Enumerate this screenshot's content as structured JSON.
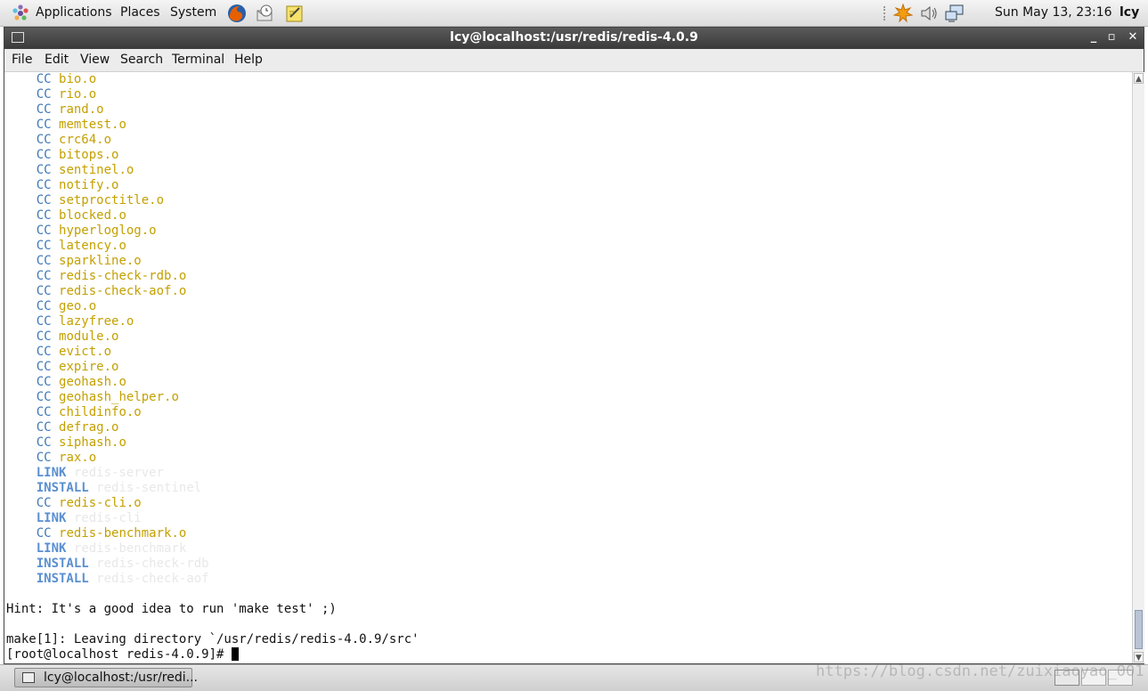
{
  "top_panel": {
    "menus": [
      "Applications",
      "Places",
      "System"
    ],
    "clock": "Sun May 13, 23:16",
    "user": "lcy"
  },
  "window": {
    "title": "lcy@localhost:/usr/redis/redis-4.0.9",
    "controls": [
      "_",
      "▫",
      "✕"
    ]
  },
  "menubar": [
    "File",
    "Edit",
    "View",
    "Search",
    "Terminal",
    "Help"
  ],
  "terminal": {
    "build_lines": [
      {
        "cmd": "CC",
        "arg": "bio.o",
        "style": "cc"
      },
      {
        "cmd": "CC",
        "arg": "rio.o",
        "style": "cc"
      },
      {
        "cmd": "CC",
        "arg": "rand.o",
        "style": "cc"
      },
      {
        "cmd": "CC",
        "arg": "memtest.o",
        "style": "cc"
      },
      {
        "cmd": "CC",
        "arg": "crc64.o",
        "style": "cc"
      },
      {
        "cmd": "CC",
        "arg": "bitops.o",
        "style": "cc"
      },
      {
        "cmd": "CC",
        "arg": "sentinel.o",
        "style": "cc"
      },
      {
        "cmd": "CC",
        "arg": "notify.o",
        "style": "cc"
      },
      {
        "cmd": "CC",
        "arg": "setproctitle.o",
        "style": "cc"
      },
      {
        "cmd": "CC",
        "arg": "blocked.o",
        "style": "cc"
      },
      {
        "cmd": "CC",
        "arg": "hyperloglog.o",
        "style": "cc"
      },
      {
        "cmd": "CC",
        "arg": "latency.o",
        "style": "cc"
      },
      {
        "cmd": "CC",
        "arg": "sparkline.o",
        "style": "cc"
      },
      {
        "cmd": "CC",
        "arg": "redis-check-rdb.o",
        "style": "cc"
      },
      {
        "cmd": "CC",
        "arg": "redis-check-aof.o",
        "style": "cc"
      },
      {
        "cmd": "CC",
        "arg": "geo.o",
        "style": "cc"
      },
      {
        "cmd": "CC",
        "arg": "lazyfree.o",
        "style": "cc"
      },
      {
        "cmd": "CC",
        "arg": "module.o",
        "style": "cc"
      },
      {
        "cmd": "CC",
        "arg": "evict.o",
        "style": "cc"
      },
      {
        "cmd": "CC",
        "arg": "expire.o",
        "style": "cc"
      },
      {
        "cmd": "CC",
        "arg": "geohash.o",
        "style": "cc"
      },
      {
        "cmd": "CC",
        "arg": "geohash_helper.o",
        "style": "cc"
      },
      {
        "cmd": "CC",
        "arg": "childinfo.o",
        "style": "cc"
      },
      {
        "cmd": "CC",
        "arg": "defrag.o",
        "style": "cc"
      },
      {
        "cmd": "CC",
        "arg": "siphash.o",
        "style": "cc"
      },
      {
        "cmd": "CC",
        "arg": "rax.o",
        "style": "cc"
      },
      {
        "cmd": "LINK",
        "arg": "redis-server",
        "style": "link"
      },
      {
        "cmd": "INSTALL",
        "arg": "redis-sentinel",
        "style": "link"
      },
      {
        "cmd": "CC",
        "arg": "redis-cli.o",
        "style": "cc"
      },
      {
        "cmd": "LINK",
        "arg": "redis-cli",
        "style": "link"
      },
      {
        "cmd": "CC",
        "arg": "redis-benchmark.o",
        "style": "cc"
      },
      {
        "cmd": "LINK",
        "arg": "redis-benchmark",
        "style": "link"
      },
      {
        "cmd": "INSTALL",
        "arg": "redis-check-rdb",
        "style": "link"
      },
      {
        "cmd": "INSTALL",
        "arg": "redis-check-aof",
        "style": "link"
      }
    ],
    "hint": "Hint: It's a good idea to run 'make test' ;)",
    "leaving": "make[1]: Leaving directory `/usr/redis/redis-4.0.9/src'",
    "prompt": "[root@localhost redis-4.0.9]# "
  },
  "taskbar": {
    "task_label": "lcy@localhost:/usr/redi..."
  },
  "watermark": "https://blog.csdn.net/zuixiaoyao_001"
}
